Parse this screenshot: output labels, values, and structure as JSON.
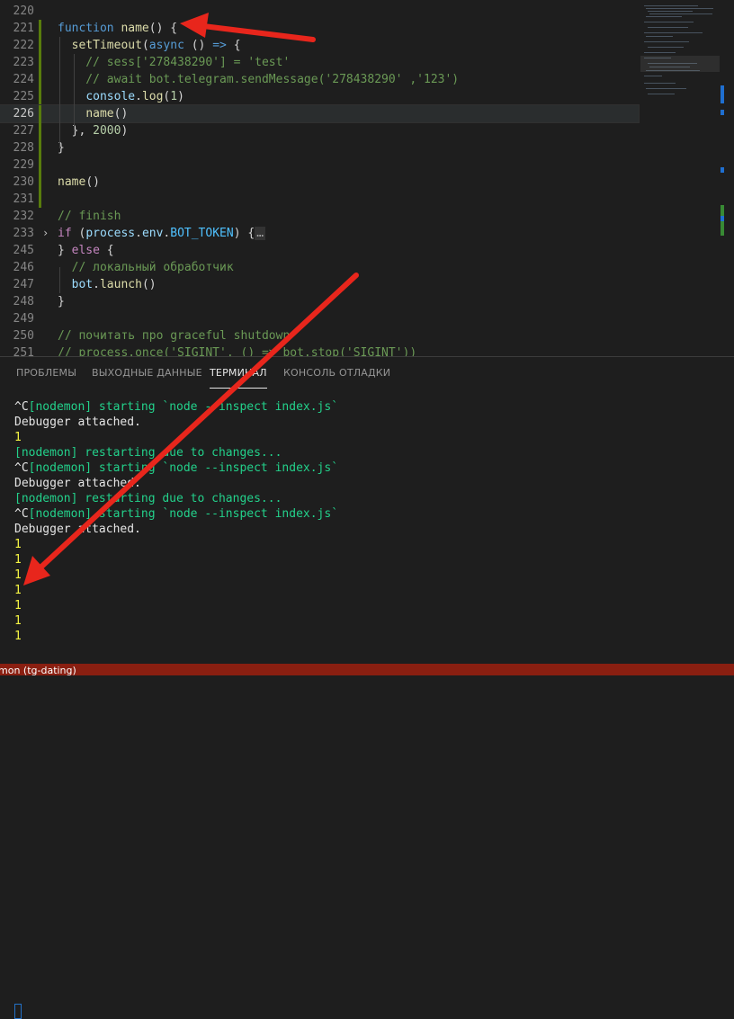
{
  "editor": {
    "lines": [
      {
        "num": "220",
        "tokens": []
      },
      {
        "num": "221",
        "tokens": [
          {
            "t": "function ",
            "c": "t-kw2"
          },
          {
            "t": "name",
            "c": "t-fn"
          },
          {
            "t": "() {",
            "c": "t-pun"
          }
        ]
      },
      {
        "num": "222",
        "tokens": [
          {
            "t": "  ",
            "c": "t-pun"
          },
          {
            "t": "setTimeout",
            "c": "t-fn"
          },
          {
            "t": "(",
            "c": "t-pun"
          },
          {
            "t": "async",
            "c": "t-kw2"
          },
          {
            "t": " () ",
            "c": "t-pun"
          },
          {
            "t": "=>",
            "c": "t-kw2"
          },
          {
            "t": " {",
            "c": "t-pun"
          }
        ]
      },
      {
        "num": "223",
        "tokens": [
          {
            "t": "    // sess['278438290'] = 'test'",
            "c": "t-cm"
          }
        ]
      },
      {
        "num": "224",
        "tokens": [
          {
            "t": "    // await bot.telegram.sendMessage('278438290' ,'123')",
            "c": "t-cm"
          }
        ]
      },
      {
        "num": "225",
        "tokens": [
          {
            "t": "    ",
            "c": "t-pun"
          },
          {
            "t": "console",
            "c": "t-var"
          },
          {
            "t": ".",
            "c": "t-pun"
          },
          {
            "t": "log",
            "c": "t-fn"
          },
          {
            "t": "(",
            "c": "t-pun"
          },
          {
            "t": "1",
            "c": "t-num"
          },
          {
            "t": ")",
            "c": "t-pun"
          }
        ]
      },
      {
        "num": "226",
        "tokens": [
          {
            "t": "    ",
            "c": "t-pun"
          },
          {
            "t": "name",
            "c": "t-fn"
          },
          {
            "t": "()",
            "c": "t-pun"
          }
        ]
      },
      {
        "num": "227",
        "tokens": [
          {
            "t": "  }, ",
            "c": "t-pun"
          },
          {
            "t": "2000",
            "c": "t-num"
          },
          {
            "t": ")",
            "c": "t-pun"
          }
        ]
      },
      {
        "num": "228",
        "tokens": [
          {
            "t": "}",
            "c": "t-pun"
          }
        ]
      },
      {
        "num": "229",
        "tokens": []
      },
      {
        "num": "230",
        "tokens": [
          {
            "t": "name",
            "c": "t-fn"
          },
          {
            "t": "()",
            "c": "t-pun"
          }
        ]
      },
      {
        "num": "231",
        "tokens": []
      },
      {
        "num": "232",
        "tokens": [
          {
            "t": "// finish",
            "c": "t-cm"
          }
        ]
      },
      {
        "num": "233",
        "tokens": [
          {
            "t": "if",
            "c": "t-kw"
          },
          {
            "t": " (",
            "c": "t-pun"
          },
          {
            "t": "process",
            "c": "t-var"
          },
          {
            "t": ".",
            "c": "t-pun"
          },
          {
            "t": "env",
            "c": "t-var"
          },
          {
            "t": ".",
            "c": "t-pun"
          },
          {
            "t": "BOT_TOKEN",
            "c": "t-const"
          },
          {
            "t": ") {",
            "c": "t-pun"
          },
          {
            "t": "…",
            "c": "t-fold"
          }
        ]
      },
      {
        "num": "245",
        "tokens": [
          {
            "t": "} ",
            "c": "t-pun"
          },
          {
            "t": "else",
            "c": "t-kw"
          },
          {
            "t": " {",
            "c": "t-pun"
          }
        ]
      },
      {
        "num": "246",
        "tokens": [
          {
            "t": "  // локальный обработчик",
            "c": "t-cm"
          }
        ]
      },
      {
        "num": "247",
        "tokens": [
          {
            "t": "  ",
            "c": "t-pun"
          },
          {
            "t": "bot",
            "c": "t-var"
          },
          {
            "t": ".",
            "c": "t-pun"
          },
          {
            "t": "launch",
            "c": "t-fn"
          },
          {
            "t": "()",
            "c": "t-pun"
          }
        ]
      },
      {
        "num": "248",
        "tokens": [
          {
            "t": "}",
            "c": "t-pun"
          }
        ]
      },
      {
        "num": "249",
        "tokens": []
      },
      {
        "num": "250",
        "tokens": [
          {
            "t": "// почитать про graceful shutdown",
            "c": "t-cm"
          }
        ]
      },
      {
        "num": "251",
        "tokens": [
          {
            "t": "// process.once('SIGINT', () => bot.stop('SIGINT'))",
            "c": "t-cm"
          }
        ]
      }
    ],
    "active_line": "226"
  },
  "panel": {
    "tabs": [
      "ПРОБЛЕМЫ",
      "ВЫХОДНЫЕ ДАННЫЕ",
      "ТЕРМИНАЛ",
      "КОНСОЛЬ ОТЛАДКИ"
    ],
    "active_tab": "ТЕРМИНАЛ",
    "terminal": [
      {
        "segs": [
          {
            "t": "^C",
            "c": "t-white"
          },
          {
            "t": "[nodemon] starting `node --inspect index.js`",
            "c": "t-green"
          }
        ]
      },
      {
        "segs": [
          {
            "t": "Debugger attached.",
            "c": "t-white"
          }
        ]
      },
      {
        "segs": [
          {
            "t": "1",
            "c": "t-yellow"
          }
        ]
      },
      {
        "segs": [
          {
            "t": "[nodemon] restarting due to changes...",
            "c": "t-green"
          }
        ]
      },
      {
        "segs": [
          {
            "t": "^C",
            "c": "t-white"
          },
          {
            "t": "[nodemon] starting `node --inspect index.js`",
            "c": "t-green"
          }
        ]
      },
      {
        "segs": [
          {
            "t": "Debugger attached.",
            "c": "t-white"
          }
        ]
      },
      {
        "segs": [
          {
            "t": "[nodemon] restarting due to changes...",
            "c": "t-green"
          }
        ]
      },
      {
        "segs": [
          {
            "t": "^C",
            "c": "t-white"
          },
          {
            "t": "[nodemon] starting `node --inspect index.js`",
            "c": "t-green"
          }
        ]
      },
      {
        "segs": [
          {
            "t": "Debugger attached.",
            "c": "t-white"
          }
        ]
      },
      {
        "segs": [
          {
            "t": "1",
            "c": "t-yellow"
          }
        ]
      },
      {
        "segs": [
          {
            "t": "1",
            "c": "t-yellow"
          }
        ]
      },
      {
        "segs": [
          {
            "t": "1",
            "c": "t-yellow"
          }
        ]
      },
      {
        "segs": [
          {
            "t": "1",
            "c": "t-yellow"
          }
        ]
      },
      {
        "segs": [
          {
            "t": "1",
            "c": "t-yellow"
          }
        ]
      },
      {
        "segs": [
          {
            "t": "1",
            "c": "t-yellow"
          }
        ]
      },
      {
        "segs": [
          {
            "t": "1",
            "c": "t-yellow"
          }
        ]
      }
    ]
  },
  "statusbar": {
    "text": "mon (tg-dating)"
  },
  "colors": {
    "annotation_arrow": "#e8261c",
    "statusbar": "#8a1f11",
    "modified_gutter": "#587c0c"
  }
}
